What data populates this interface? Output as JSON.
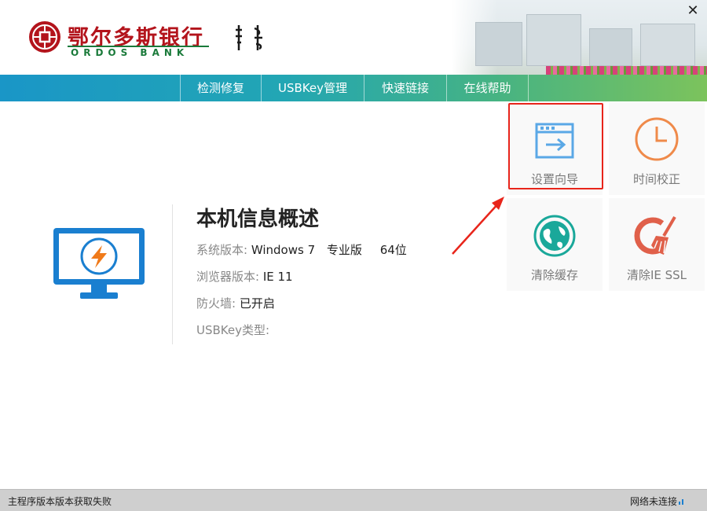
{
  "header": {
    "brand_cn": "鄂尔多斯银行",
    "brand_en": "ORDOS BANK",
    "close_symbol": "✕"
  },
  "nav": {
    "items": [
      {
        "label": "检测修复"
      },
      {
        "label": "USBKey管理"
      },
      {
        "label": "快速链接"
      },
      {
        "label": "在线帮助"
      }
    ]
  },
  "info": {
    "title": "本机信息概述",
    "rows": [
      {
        "label": "系统版本:",
        "value": "Windows 7",
        "edition": "专业版",
        "bits": "64位"
      },
      {
        "label": "浏览器版本:",
        "value": "IE 11"
      },
      {
        "label": "防火墙:",
        "value": "已开启"
      },
      {
        "label": "USBKey类型:",
        "value": ""
      }
    ]
  },
  "tiles": {
    "setup": "设置向导",
    "time": "时间校正",
    "cache": "清除缓存",
    "ssl": "清除IE SSL"
  },
  "status": {
    "left": "主程序版本版本获取失败",
    "right": "网络未连接"
  },
  "colors": {
    "brand_red": "#b3141c",
    "brand_green": "#1a7a3a",
    "monitor_blue": "#1a7fd0",
    "highlight_red": "#e8251b",
    "tile_blue": "#5aa8e6",
    "tile_orange": "#ef8a4a",
    "tile_teal": "#1aa89a",
    "tile_red": "#e0604a"
  }
}
